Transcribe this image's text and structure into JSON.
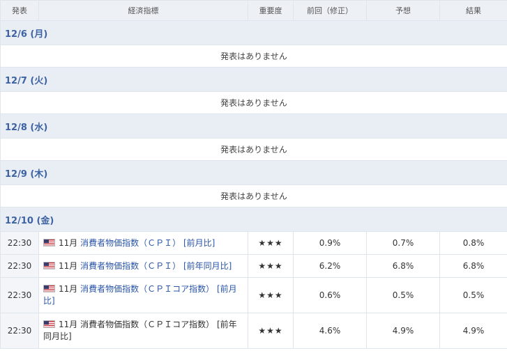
{
  "headers": {
    "time": "発表",
    "indicator": "経済指標",
    "importance": "重要度",
    "previous": "前回（修正）",
    "forecast": "予想",
    "result": "結果"
  },
  "no_release_text": "発表はありません",
  "days": [
    {
      "label": "12/6 (月)"
    },
    {
      "label": "12/7 (火)"
    },
    {
      "label": "12/8 (水)"
    },
    {
      "label": "12/9 (木)"
    },
    {
      "label": "12/10 (金)"
    }
  ],
  "events": [
    {
      "time": "22:30",
      "month": "11月",
      "name": "消費者物価指数（ＣＰＩ）",
      "period": "[前月比]",
      "stars": "★★★",
      "previous": "0.9%",
      "forecast": "0.7%",
      "result": "0.8%",
      "flag": "us-flag-icon"
    },
    {
      "time": "22:30",
      "month": "11月",
      "name": "消費者物価指数（ＣＰＩ）",
      "period": "[前年同月比]",
      "stars": "★★★",
      "previous": "6.2%",
      "forecast": "6.8%",
      "result": "6.8%",
      "flag": "us-flag-icon"
    },
    {
      "time": "22:30",
      "month": "11月",
      "name": "消費者物価指数（ＣＰＩコア指数）",
      "period": "[前月比]",
      "stars": "★★★",
      "previous": "0.6%",
      "forecast": "0.5%",
      "result": "0.5%",
      "flag": "us-flag-icon"
    },
    {
      "time": "22:30",
      "month": "11月",
      "name": "消費者物価指数（ＣＰＩコア指数）",
      "period": "[前年同月比]",
      "stars": "★★★",
      "previous": "4.6%",
      "forecast": "4.9%",
      "result": "4.9%",
      "flag": "us-flag-icon"
    }
  ],
  "colors": {
    "day_label": "#3d62a3",
    "link": "#2a55a8",
    "star": "#e8673c"
  }
}
